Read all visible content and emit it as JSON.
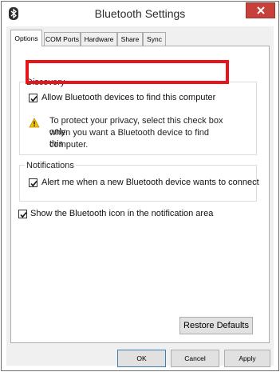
{
  "window": {
    "title": "Bluetooth Settings"
  },
  "tabs": [
    {
      "label": "Options",
      "active": true
    },
    {
      "label": "COM Ports",
      "active": false
    },
    {
      "label": "Hardware",
      "active": false
    },
    {
      "label": "Share",
      "active": false
    },
    {
      "label": "Sync",
      "active": false
    }
  ],
  "discovery": {
    "group_label": "Discovery",
    "allow_checkbox_label": "Allow Bluetooth devices to find this computer",
    "allow_checked": true,
    "warning_line1": "To protect your privacy, select this check box only",
    "warning_line2": "when you want a Bluetooth device to find this",
    "warning_line3": "computer."
  },
  "notifications": {
    "group_label": "Notifications",
    "alert_checkbox_label": "Alert me when a new Bluetooth device wants to connect",
    "alert_checked": true
  },
  "show_icon": {
    "label": "Show the Bluetooth icon in the notification area",
    "checked": true
  },
  "buttons": {
    "restore_defaults": "Restore Defaults",
    "ok": "OK",
    "cancel": "Cancel",
    "apply": "Apply"
  },
  "colors": {
    "highlight_border": "#e8141b",
    "close_button": "#c7403a",
    "bluetooth_icon": "#2f2f2f",
    "warning_icon": "#f3c300"
  },
  "icons": {
    "title_icon": "bluetooth-icon",
    "close": "close-icon",
    "warning": "warning-icon",
    "check": "check-icon"
  }
}
